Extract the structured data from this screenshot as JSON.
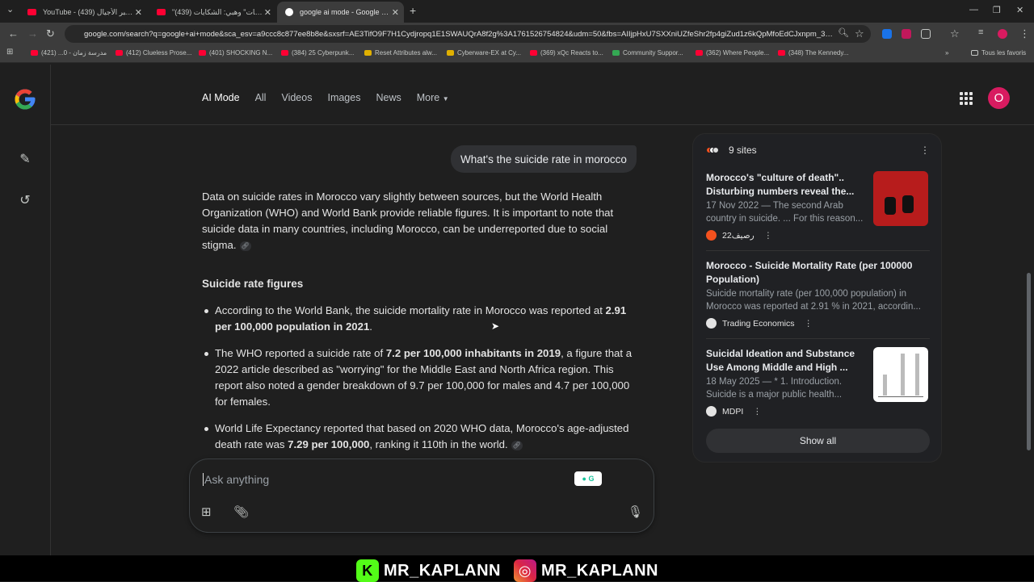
{
  "browser": {
    "tabs": [
      {
        "title": "YouTube - حوار عبر الأجيال (439)",
        "active": false
      },
      {
        "title": "\"بلا إثبات\" وهبي: الشكايات (439)",
        "active": false
      },
      {
        "title": "google ai mode - Google Search",
        "active": true
      }
    ],
    "new_tab": "+",
    "url": "google.com/search?q=google+ai+mode&sca_esv=a9ccc8c877ee8b8e&sxsrf=AE3TifO9F7H1Cydjropq1E1SWAUQrA8f2g%3A1761526754824&udm=50&fbs=AIIjpHxU7SXXniUZfeShr2fp4giZud1z6kQpMfoEdCJxnpm_3UK3oy...",
    "bookmarks": [
      "مدرسة زمان - 0... (421)",
      "(412) Clueless Prose...",
      "(401) SHOCKING N...",
      "(384) 25 Cyberpunk...",
      "Reset Attributes alw...",
      "Cyberware-EX at Cy...",
      "(369) xQc Reacts to...",
      "Community Suppor...",
      "(362) Where People...",
      "(348) The Kennedy..."
    ],
    "all_bookmarks": "Tous les favoris"
  },
  "header": {
    "tabs": [
      {
        "label": "AI Mode",
        "active": true
      },
      {
        "label": "All",
        "active": false
      },
      {
        "label": "Videos",
        "active": false
      },
      {
        "label": "Images",
        "active": false
      },
      {
        "label": "News",
        "active": false
      },
      {
        "label": "More",
        "active": false
      }
    ],
    "avatar_letter": "O"
  },
  "conversation": {
    "query": "What's the suicide rate in morocco",
    "intro": "Data on suicide rates in Morocco vary slightly between sources, but the World Health Organization (WHO) and World Bank provide reliable figures. It is important to note that suicide data in many countries, including Morocco, can be underreported due to social stigma.",
    "section_title": "Suicide rate figures",
    "bullets": [
      {
        "pre": "According to the World Bank, the suicide mortality rate in Morocco was reported at ",
        "bold": "2.91 per 100,000 population in 2021",
        "post": "."
      },
      {
        "pre": "The WHO reported a suicide rate of ",
        "bold": "7.2 per 100,000 inhabitants in 2019",
        "post": ", a figure that a 2022 article described as \"worrying\" for the Middle East and North Africa region. This report also noted a gender breakdown of 9.7 per 100,000 for males and 4.7 per 100,000 for females."
      },
      {
        "pre": "World Life Expectancy reported that based on 2020 WHO data, Morocco's age-adjusted death rate was ",
        "bold": "7.29 per 100,000",
        "post": ", ranking it 110th in the world."
      }
    ]
  },
  "ask": {
    "placeholder": "Ask anything"
  },
  "sources": {
    "count_label": "9 sites",
    "cards": [
      {
        "title": "Morocco's \"culture of death\".. Disturbing numbers reveal the...",
        "snippet": "17 Nov 2022 — The second Arab country in suicide. ... For this reason...",
        "source": "رصيف22"
      },
      {
        "title": "Morocco - Suicide Mortality Rate (per 100000 Population)",
        "snippet": "Suicide mortality rate (per 100,000 population) in Morocco was reported at 2.91 % in 2021, accordin...",
        "source": "Trading Economics"
      },
      {
        "title": "Suicidal Ideation and Substance Use Among Middle and High ...",
        "snippet": "18 May 2025 — * 1. Introduction. Suicide is a major public health...",
        "source": "MDPI"
      }
    ],
    "show_all": "Show all"
  },
  "footer": {
    "handle_1": "MR_KAPLANN",
    "handle_2": "MR_KAPLANN"
  },
  "colors": {
    "youtube": "#ff0033",
    "avatar": "#d81b60",
    "kick": "#53fc18"
  }
}
